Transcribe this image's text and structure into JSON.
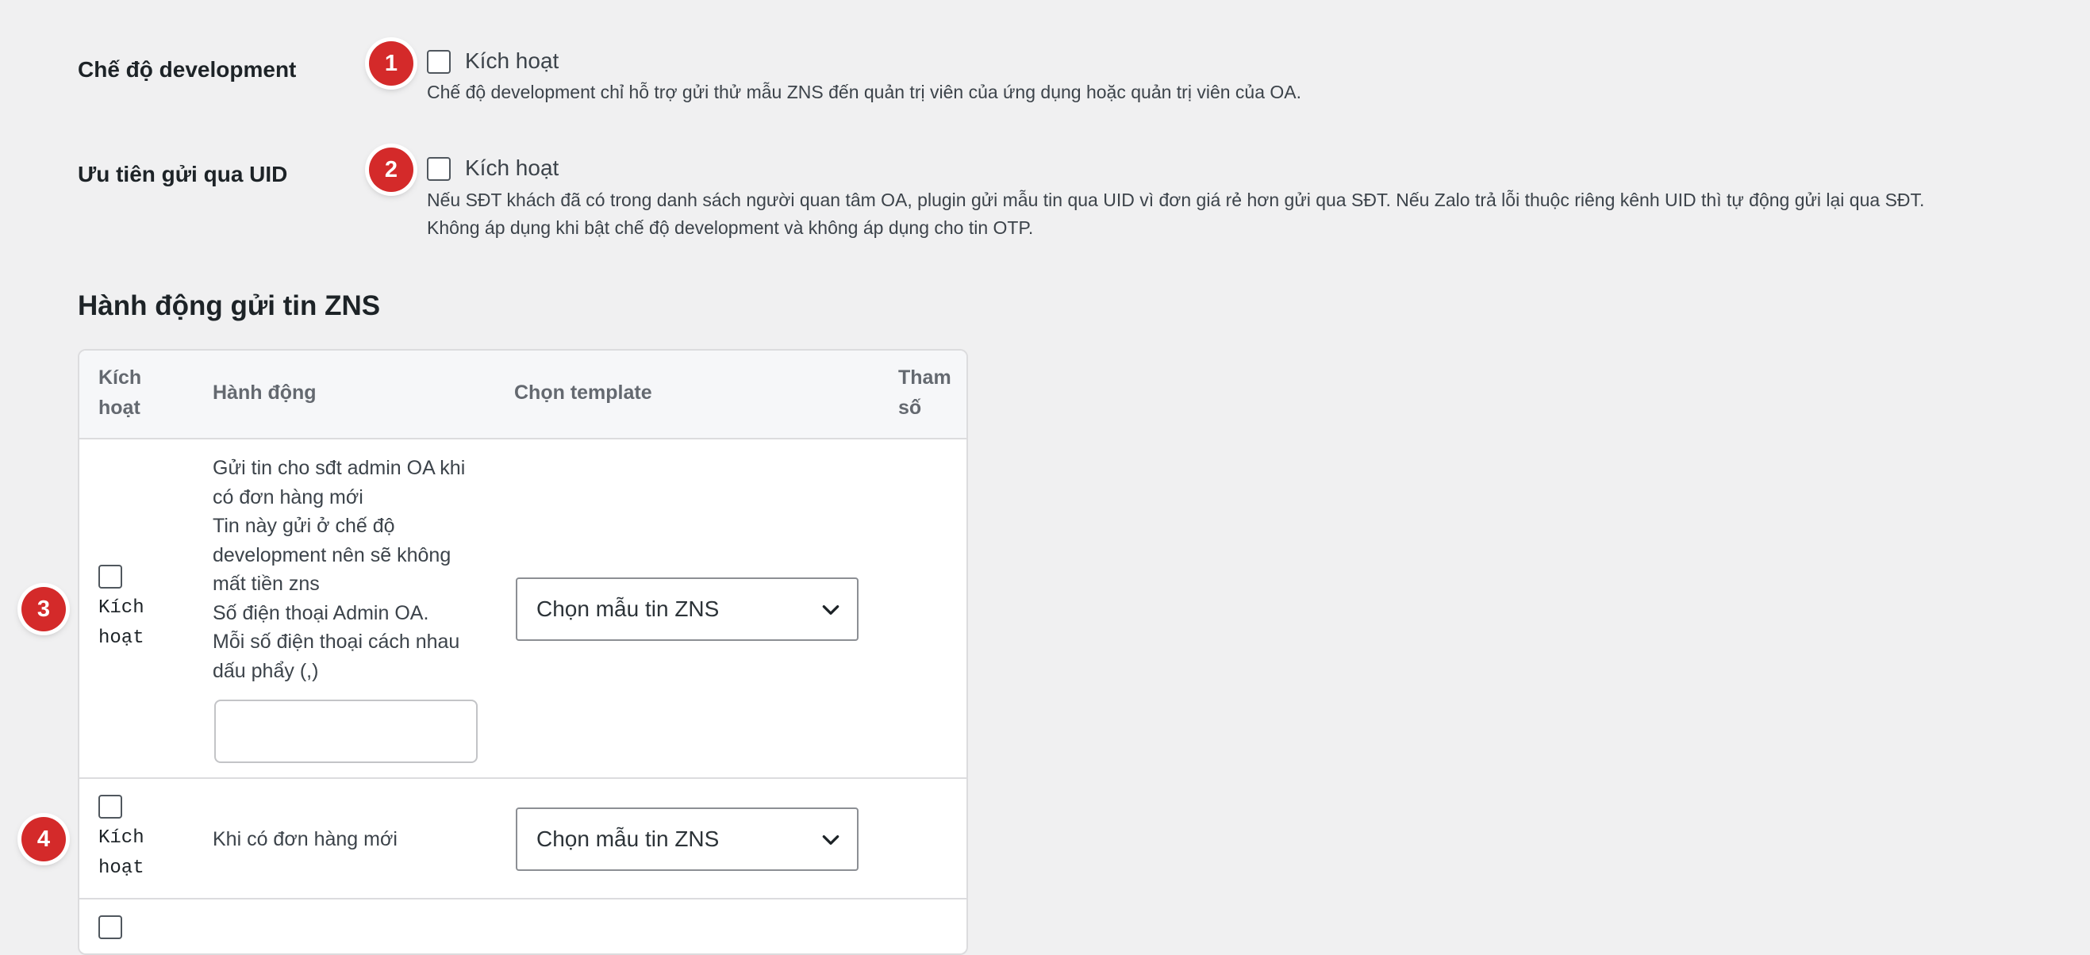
{
  "settings": {
    "development_mode": {
      "label": "Chế độ development",
      "badge": "1",
      "checkbox_label": "Kích hoạt",
      "checked": false,
      "description": "Chế độ development chỉ hỗ trợ gửi thử mẫu ZNS đến quản trị viên của ứng dụng hoặc quản trị viên của OA."
    },
    "uid_priority": {
      "label": "Ưu tiên gửi qua UID",
      "badge": "2",
      "checkbox_label": "Kích hoạt",
      "checked": false,
      "description_line1": "Nếu SĐT khách đã có trong danh sách người quan tâm OA, plugin gửi mẫu tin qua UID vì đơn giá rẻ hơn gửi qua SĐT. Nếu Zalo trả lỗi thuộc riêng kênh UID thì tự động gửi lại qua SĐT.",
      "description_line2": "Không áp dụng khi bật chế độ development và không áp dụng cho tin OTP."
    }
  },
  "actions_section": {
    "title": "Hành động gửi tin ZNS",
    "columns": {
      "enable_line1": "Kích",
      "enable_line2": "hoạt",
      "action": "Hành động",
      "template": "Chọn template",
      "params_line1": "Tham",
      "params_line2": "số"
    },
    "rows": [
      {
        "badge": "3",
        "checked": false,
        "enable_line1": "Kích",
        "enable_line2": "hoạt",
        "action_lines": [
          "Gửi tin cho sđt admin OA khi",
          "có đơn hàng mới",
          "Tin này gửi ở chế độ",
          "development nên sẽ không",
          "mất tiền zns",
          "Số điện thoại Admin OA.",
          "Mỗi số điện thoại cách nhau",
          "dấu phẩy (,)"
        ],
        "phone_input_value": "",
        "template_select": "Chọn mẫu tin ZNS"
      },
      {
        "badge": "4",
        "checked": false,
        "enable_line1": "Kích",
        "enable_line2": "hoạt",
        "action": "Khi có đơn hàng mới",
        "template_select": "Chọn mẫu tin ZNS"
      }
    ]
  },
  "colors": {
    "page_bg": "#f0f0f1",
    "badge": "#d42a2a",
    "table_header_bg": "#f6f7f9",
    "border": "#dcdcde"
  },
  "icons": {
    "select_arrow": "chevron-down-icon"
  }
}
